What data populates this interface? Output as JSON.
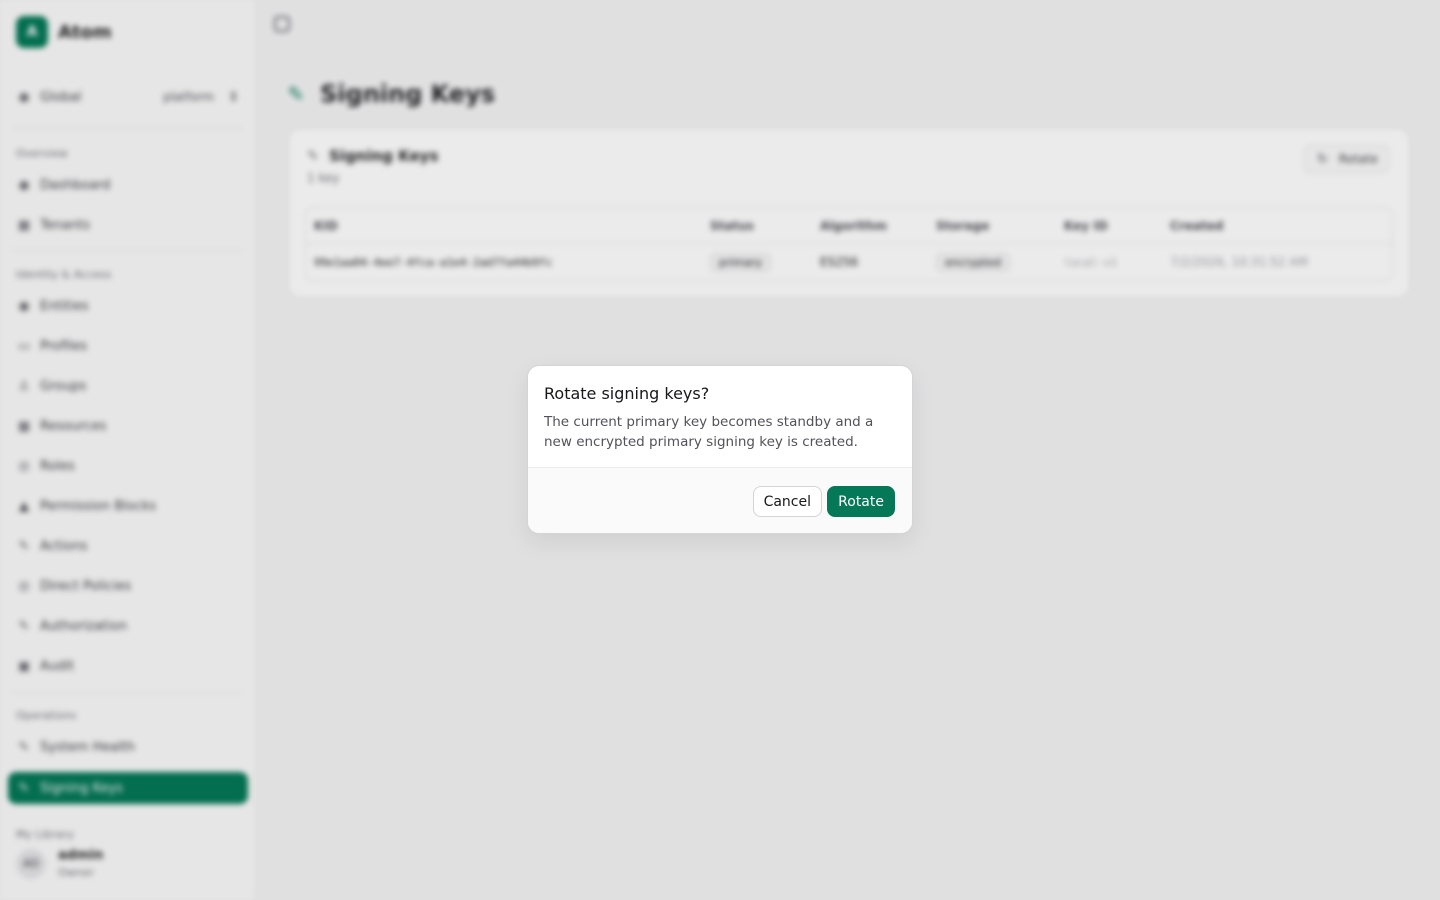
{
  "brand": {
    "logo_glyph": "A",
    "name": "Atom"
  },
  "tenant": {
    "label": "Global",
    "selected": "platform"
  },
  "sidebar": {
    "sections": [
      {
        "label": "Overview",
        "items": [
          {
            "label": "Dashboard",
            "icon": "◉"
          },
          {
            "label": "Tenants",
            "icon": "▦"
          }
        ]
      },
      {
        "label": "Identity & Access",
        "items": [
          {
            "label": "Entities",
            "icon": "◉"
          },
          {
            "label": "Profiles",
            "icon": "▭"
          },
          {
            "label": "Groups",
            "icon": "♙"
          },
          {
            "label": "Resources",
            "icon": "▦"
          },
          {
            "label": "Roles",
            "icon": "◎"
          },
          {
            "label": "Permission Blocks",
            "icon": "▲"
          },
          {
            "label": "Actions",
            "icon": "✎"
          },
          {
            "label": "Direct Policies",
            "icon": "◎"
          },
          {
            "label": "Authorization",
            "icon": "✎"
          },
          {
            "label": "Audit",
            "icon": "▣"
          }
        ]
      },
      {
        "label": "Operations",
        "items": [
          {
            "label": "System Health",
            "icon": "✎"
          },
          {
            "label": "Signing Keys",
            "icon": "✎",
            "active": true
          }
        ]
      }
    ],
    "footer_label": "My Library",
    "user": {
      "initials": "AD",
      "name": "admin",
      "role": "Owner"
    }
  },
  "page": {
    "title": "Signing Keys"
  },
  "card": {
    "title": "Signing Keys",
    "subtitle": "1 key",
    "rotate_label": "Rotate",
    "columns": [
      "KID",
      "Status",
      "Algorithm",
      "Storage",
      "Key ID",
      "Created"
    ],
    "rows": [
      {
        "kid": "99e1aa04-4ee7-4fca-a1e4-2ad7fa44b9fc",
        "status": "primary",
        "algorithm": "ES256",
        "storage": "encrypted",
        "key_id": "local-v1",
        "created": "7/2/2026, 10:31:52 AM"
      }
    ]
  },
  "dialog": {
    "title": "Rotate signing keys?",
    "description": "The current primary key becomes standby and a new encrypted primary signing key is created.",
    "cancel_label": "Cancel",
    "confirm_label": "Rotate"
  }
}
